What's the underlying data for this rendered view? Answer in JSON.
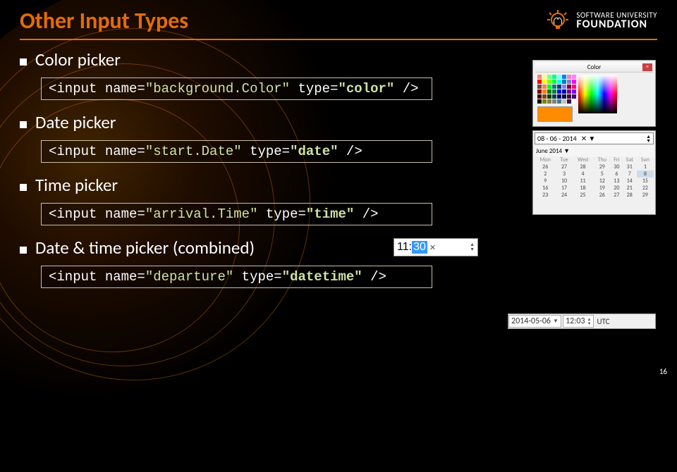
{
  "title": "Other Input Types",
  "logo": {
    "line1": "SOFTWARE UNIVERSITY",
    "line2": "FOUNDATION"
  },
  "bullets": {
    "b1": "Color picker",
    "b2": "Date picker",
    "b3": "Time picker",
    "b4": "Date & time picker (combined)"
  },
  "code": {
    "c1_open": "<input ",
    "c1_na": "name=",
    "c1_nv": "\"background.Color\"",
    "c1_ta": " type=",
    "c1_tv": "\"color\"",
    "c1_close": " />",
    "c2_nv": "\"start.Date\"",
    "c2_tv": "\"date\"",
    "c3_nv": "\"arrival.Time\"",
    "c3_tv": "\"time\"",
    "c4_nv": "\"departure\"",
    "c4_tv": "\"datetime\""
  },
  "thumbnails": {
    "color": {
      "title": "Color",
      "swatch": "#ff8c00"
    },
    "date": {
      "input_value": "08 - 06 - 2014",
      "month_label": "June 2014 ▼",
      "weekdays": [
        "Mon",
        "Tue",
        "Wed",
        "Thu",
        "Fri",
        "Sat",
        "Sun"
      ]
    },
    "time": {
      "hour": "11",
      "sep": ":",
      "minute": "30"
    },
    "datetime": {
      "date": "2014-05-06",
      "time": "12:03",
      "tz": "UTC"
    }
  },
  "page_number": "16"
}
